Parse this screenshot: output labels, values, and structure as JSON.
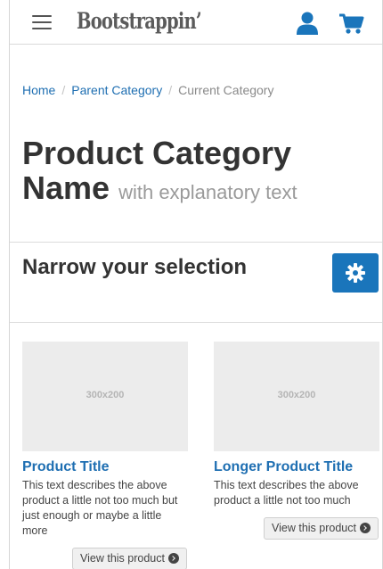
{
  "navbar": {
    "brand": "Bootstrappin’",
    "menu_icon": "hamburger-menu-icon",
    "user_icon": "user-icon",
    "cart_icon": "shopping-cart-icon",
    "accent_color": "#1a75bb"
  },
  "breadcrumb": {
    "items": [
      {
        "label": "Home"
      },
      {
        "label": "Parent Category"
      },
      {
        "label": "Current Category"
      }
    ],
    "separator": "/"
  },
  "page": {
    "title": "Product Category Name",
    "subtitle": "with explanatory text"
  },
  "filter": {
    "heading": "Narrow your selection",
    "button_icon": "gear-icon"
  },
  "products": [
    {
      "placeholder": "300x200",
      "title": "Product Title",
      "description": "This text describes the above product a little not too much but just enough or maybe a little more",
      "button_label": "View this product"
    },
    {
      "placeholder": "300x200",
      "title": "Longer Product Title",
      "description": "This text describes the above product a little not too much",
      "button_label": "View this product"
    }
  ]
}
